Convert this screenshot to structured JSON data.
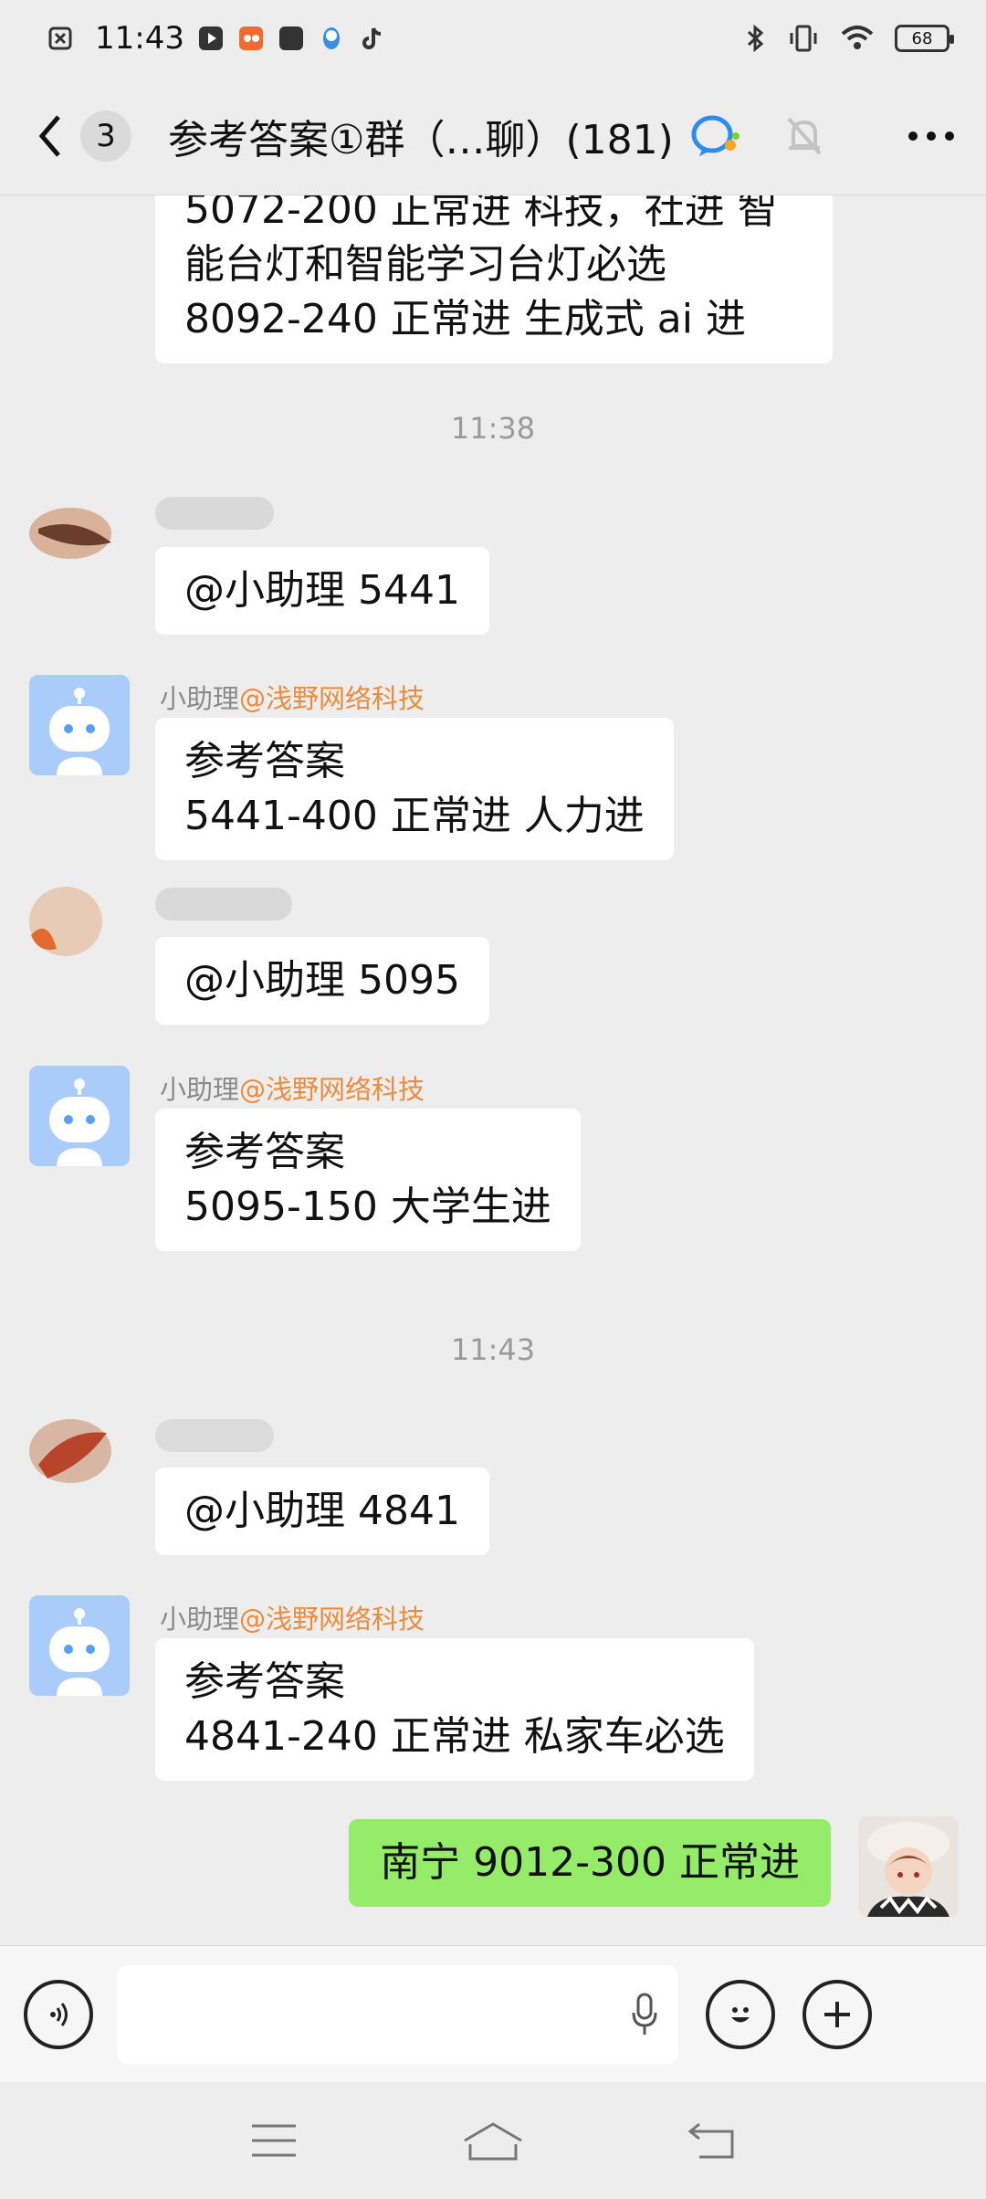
{
  "status_bar": {
    "time": "11:43",
    "battery": "68"
  },
  "header": {
    "unread_count": "3",
    "title": "参考答案①群（…聊）(181)"
  },
  "messages": [
    {
      "id": "m0",
      "from": "bot",
      "text": "5072-200 正常进 科技，社进 智\n能台灯和智能学习台灯必选\n8092-240 正常进 生成式 ai 进"
    },
    {
      "id": "t1",
      "timestamp": "11:38"
    },
    {
      "id": "m1",
      "from": "member",
      "text": "@小助理  5441"
    },
    {
      "id": "m2",
      "from": "bot",
      "sender_name": "小助理",
      "sender_group": "@浅野网络科技",
      "text": "参考答案\n5441-400 正常进 人力进"
    },
    {
      "id": "m3",
      "from": "member",
      "text": "@小助理   5095"
    },
    {
      "id": "m4",
      "from": "bot",
      "sender_name": "小助理",
      "sender_group": "@浅野网络科技",
      "text": "参考答案\n5095-150  大学生进"
    },
    {
      "id": "t2",
      "timestamp": "11:43"
    },
    {
      "id": "m5",
      "from": "member",
      "text": "@小助理  4841"
    },
    {
      "id": "m6",
      "from": "bot",
      "sender_name": "小助理",
      "sender_group": "@浅野网络科技",
      "text": "参考答案\n4841-240 正常进 私家车必选"
    },
    {
      "id": "m7",
      "from": "me",
      "text": "南宁 9012-300 正常进"
    }
  ],
  "input": {
    "placeholder": ""
  },
  "icons": [
    "back-icon",
    "qq-group-icon",
    "mute-bell-icon",
    "more-icon",
    "voice-icon",
    "mic-icon",
    "emoji-icon",
    "plus-icon",
    "menu-icon",
    "home-icon",
    "return-icon"
  ]
}
